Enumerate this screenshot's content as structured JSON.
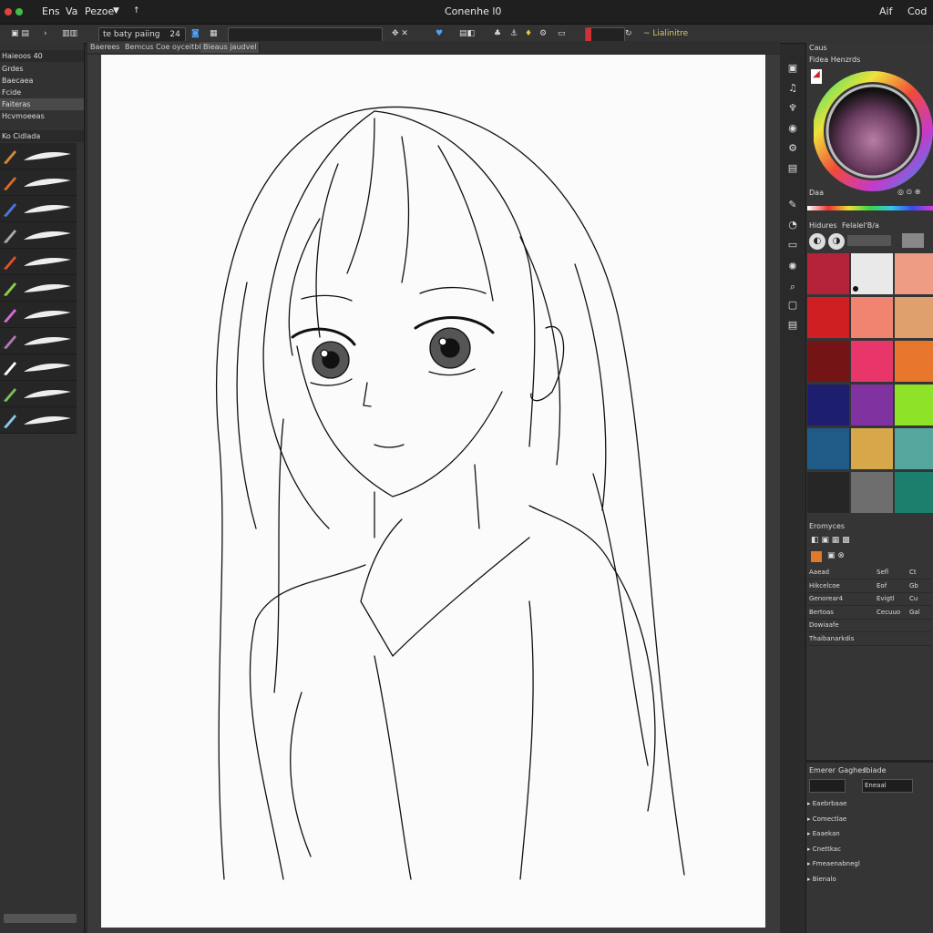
{
  "window": {
    "title": "Conenhe l0",
    "menu": [
      "Ens",
      "Va",
      "Pezoe"
    ],
    "right_menu": [
      "Aif",
      "Cod"
    ],
    "dropdown_glyph": "▼",
    "extra_glyph": "↑"
  },
  "toolbar": {
    "file_label": "te baty paiing",
    "size_value": "24",
    "status_label": "~ Lialinitre"
  },
  "doc_tabs": [
    "Baerees",
    "Bemcus",
    "Coe oyceitbhes",
    "Bieaus jaudvel"
  ],
  "left_panel": {
    "header": "Haieoos 40",
    "items": [
      "Grdes",
      "Baecaea",
      "Fcide",
      "Faiteras",
      "Hcvmoeeas"
    ],
    "brush_header": "Ko Cidlada",
    "brush_count": 11
  },
  "right_panel": {
    "color_title": "Caus",
    "color_sub": "Fidea Henzrds",
    "color_foot": "Daa",
    "swatch_header": [
      "Hidures",
      "Felalel'B/a"
    ],
    "swatches": [
      "#b5233b",
      "#e9e9e9",
      "#ee9c84",
      "#cf1f22",
      "#f08470",
      "#dfa06e",
      "#741414",
      "#e8356a",
      "#e8762c",
      "#1e1e6e",
      "#8033a0",
      "#8ee228",
      "#205a86",
      "#d6a84a",
      "#55a69c",
      "#262626",
      "#6e6e6e",
      "#1c7f6e"
    ],
    "layers_title": "Eromyces",
    "layers": [
      {
        "name": "Aaead",
        "col2": "Sefl",
        "col3": "Ct"
      },
      {
        "name": "Hikcelcoe",
        "col2": "Eof",
        "col3": "Gb"
      },
      {
        "name": "Genorear4",
        "col2": "Evigtl",
        "col3": "Cu"
      },
      {
        "name": "Bertoas",
        "col2": "Cecuuo",
        "col3": "Gal"
      },
      {
        "name": "Dowiaafe",
        "col2": "",
        "col3": ""
      },
      {
        "name": "Thaibanarkdis",
        "col2": "",
        "col3": ""
      }
    ],
    "bottom_title": [
      "Emerer",
      "Gaghes",
      "Ibiade"
    ],
    "bottom_select": "Eneaal",
    "bottom_items": [
      "Eaebrbaae",
      "Comectlae",
      "Eaaekan",
      "Cnettkac",
      "Fmeaenabnegl",
      "Bienalo"
    ]
  },
  "colors": {
    "accent": "#3d78c9",
    "bg": "#2b2b2b",
    "panel": "#353535",
    "canvas": "#fbfbfb"
  }
}
